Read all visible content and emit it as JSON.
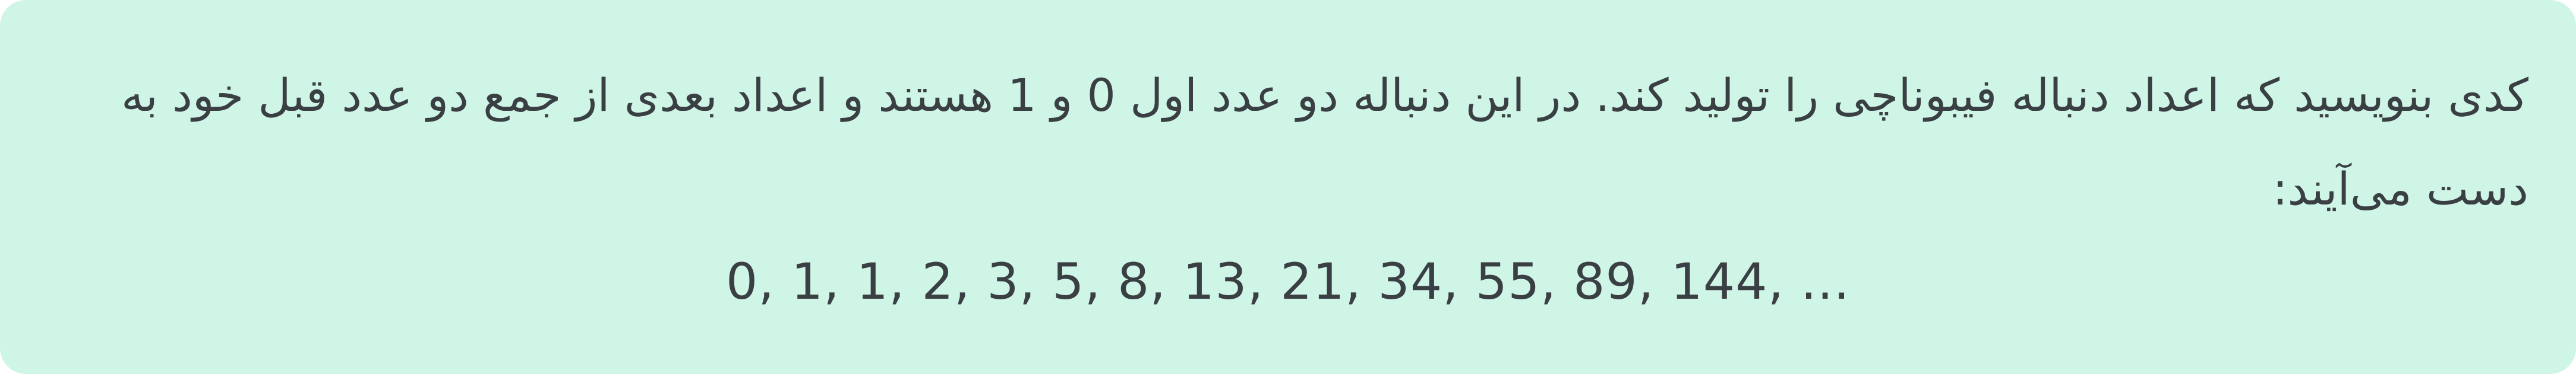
{
  "problem": {
    "description": "کدی بنویسید که اعداد دنباله فیبوناچی را تولید کند. در این دنباله دو عدد اول 0 و 1 هستند و اعداد بعدی از جمع دو عدد قبل خود به دست می‌آیند:",
    "sequence": "0, 1, 1, 2, 3, 5, 8, 13, 21, 34, 55, 89, 144, ..."
  },
  "colors": {
    "card_background": "#cff5e6",
    "text": "#3a3f44"
  }
}
